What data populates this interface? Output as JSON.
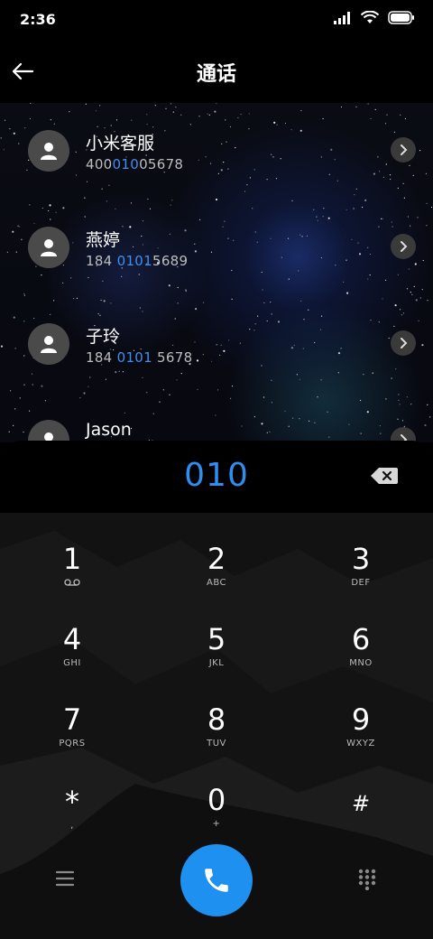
{
  "status": {
    "time": "2:36"
  },
  "header": {
    "title": "通话"
  },
  "contacts": [
    {
      "name": "小米客服",
      "num_pre": "400",
      "num_hl": "010",
      "num_post": "05678"
    },
    {
      "name": "燕婷",
      "num_pre": "184 ",
      "num_hl": "0101",
      "num_post": "5689"
    },
    {
      "name": "子玲",
      "num_pre": "184 ",
      "num_hl": "0101",
      "num_post": " 5678"
    },
    {
      "name": "Jason",
      "num_pre": "",
      "num_hl": "",
      "num_post": ""
    }
  ],
  "dialer": {
    "digits": "010",
    "keys": [
      {
        "digit": "1",
        "letters": ""
      },
      {
        "digit": "2",
        "letters": "ABC"
      },
      {
        "digit": "3",
        "letters": "DEF"
      },
      {
        "digit": "4",
        "letters": "GHI"
      },
      {
        "digit": "5",
        "letters": "JKL"
      },
      {
        "digit": "6",
        "letters": "MNO"
      },
      {
        "digit": "7",
        "letters": "PQRS"
      },
      {
        "digit": "8",
        "letters": "TUV"
      },
      {
        "digit": "9",
        "letters": "WXYZ"
      },
      {
        "digit": "*",
        "letters": ","
      },
      {
        "digit": "0",
        "letters": "+"
      },
      {
        "digit": "#",
        "letters": ""
      }
    ]
  },
  "colors": {
    "accent": "#2f8ef2",
    "call_button": "#1e90f0"
  },
  "icons": [
    "signal-icon",
    "wifi-icon",
    "battery-icon",
    "back-arrow-icon",
    "contact-avatar-icon",
    "chevron-right-icon",
    "backspace-icon",
    "voicemail-icon",
    "menu-icon",
    "phone-icon",
    "dialpad-icon"
  ]
}
